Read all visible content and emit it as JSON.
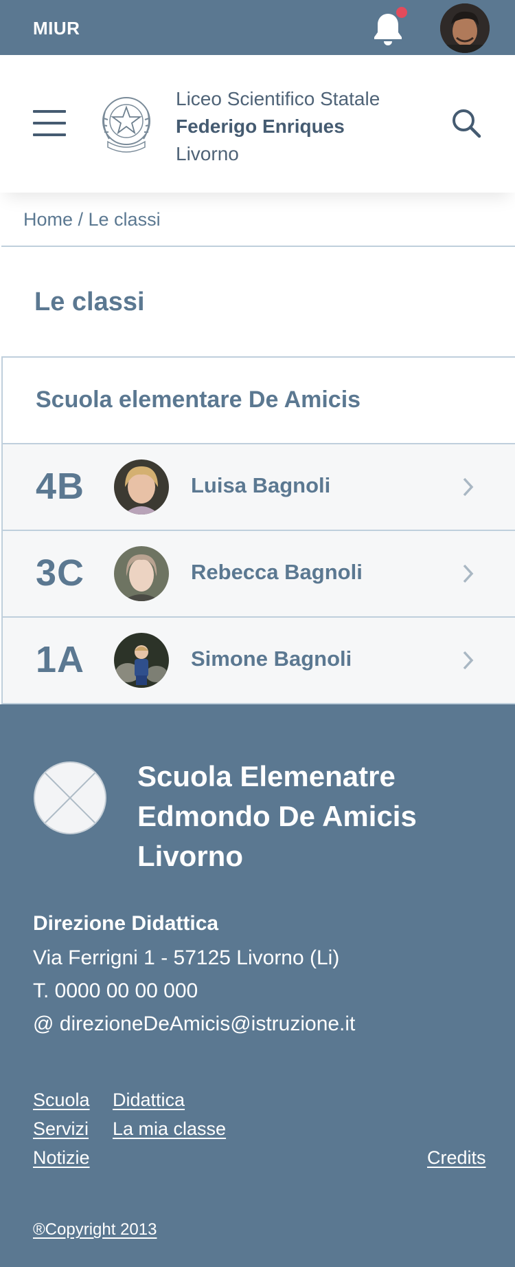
{
  "topbar": {
    "brand": "MIUR"
  },
  "header": {
    "school_line1": "Liceo Scientifico Statale",
    "school_line2": "Federigo Enriques",
    "school_line3": "Livorno"
  },
  "breadcrumb": "Home / Le classi",
  "page_title": "Le classi",
  "class_list": {
    "school": "Scuola elementare De Amicis",
    "rows": [
      {
        "class": "4B",
        "student": "Luisa Bagnoli"
      },
      {
        "class": "3C",
        "student": "Rebecca Bagnoli"
      },
      {
        "class": "1A",
        "student": "Simone Bagnoli"
      }
    ]
  },
  "footer": {
    "title_line1": "Scuola Elemenatre",
    "title_line2": "Edmondo De Amicis",
    "title_line3": "Livorno",
    "direction": "Direzione Didattica",
    "address": "Via Ferrigni 1 - 57125 Livorno (Li)",
    "phone": "T. 0000 00 00 000",
    "email": "@ direzioneDeAmicis@istruzione.it",
    "links": {
      "scuola": "Scuola",
      "didattica": "Didattica",
      "servizi": "Servizi",
      "la_mia_classe": "La mia classe",
      "notizie": "Notizie",
      "credits": "Credits"
    },
    "copyright": "®Copyright 2013"
  },
  "colors": {
    "primary": "#5b7891",
    "text": "#455b71",
    "notification": "#e34b5b",
    "divider": "#bfcfdc",
    "row_bg": "#f6f7f8"
  },
  "icons": [
    "bell-icon",
    "avatar",
    "hamburger-icon",
    "emblem-logo",
    "search-icon",
    "chevron-right-icon",
    "placeholder-logo"
  ]
}
